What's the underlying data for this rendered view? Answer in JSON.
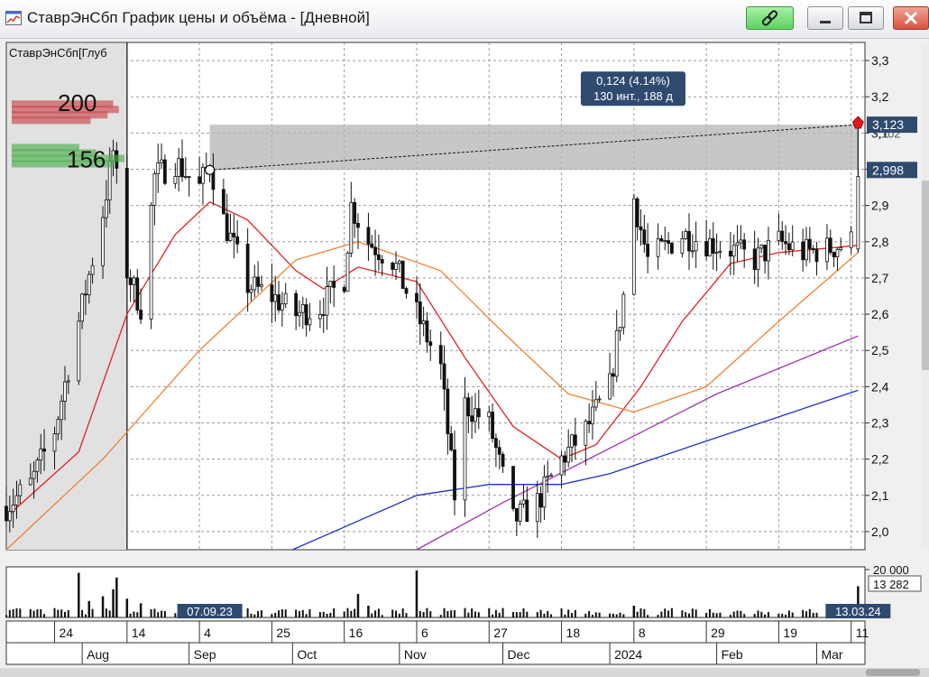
{
  "window": {
    "title": "СтаврЭнСбп График цены и объёма - [Дневной]",
    "icons": {
      "app": "chart-app-icon",
      "connect": "link-icon",
      "minimize": "minimize-icon",
      "maximize": "maximize-icon",
      "close": "close-icon"
    }
  },
  "chart_data": {
    "type": "candlestick",
    "instrument_label": "СтаврЭнСбп[Глуб",
    "ylim": [
      1.95,
      3.35
    ],
    "y_ticks": [
      "3,3",
      "3,2",
      "3,1",
      "3,0",
      "2,9",
      "2,8",
      "2,7",
      "2,6",
      "2,5",
      "2,4",
      "2,3",
      "2,2",
      "2,1",
      "2,0"
    ],
    "date_range": [
      "2023-07-10",
      "2024-03-15"
    ],
    "x_day_labels": [
      {
        "date": "2023-07-24",
        "label": "24"
      },
      {
        "date": "2023-08-14",
        "label": "14"
      },
      {
        "date": "2023-09-04",
        "label": "4"
      },
      {
        "date": "2023-09-25",
        "label": "25"
      },
      {
        "date": "2023-10-16",
        "label": "16"
      },
      {
        "date": "2023-11-06",
        "label": "6"
      },
      {
        "date": "2023-11-27",
        "label": "27"
      },
      {
        "date": "2023-12-18",
        "label": "18"
      },
      {
        "date": "2024-01-08",
        "label": "8"
      },
      {
        "date": "2024-01-29",
        "label": "29"
      },
      {
        "date": "2024-02-19",
        "label": "19"
      },
      {
        "date": "2024-03-11",
        "label": "11"
      }
    ],
    "x_month_labels": [
      {
        "date": "2023-08-01",
        "label": "Aug"
      },
      {
        "date": "2023-09-01",
        "label": "Sep"
      },
      {
        "date": "2023-10-01",
        "label": "Oct"
      },
      {
        "date": "2023-11-01",
        "label": "Nov"
      },
      {
        "date": "2023-12-01",
        "label": "Dec"
      },
      {
        "date": "2024-01-01",
        "label": "2024"
      },
      {
        "date": "2024-02-01",
        "label": "Feb"
      },
      {
        "date": "2024-03-01",
        "label": "Mar"
      }
    ],
    "price_path": [
      [
        "2023-07-10",
        2.07
      ],
      [
        "2023-07-17",
        2.13
      ],
      [
        "2023-07-24",
        2.28
      ],
      [
        "2023-07-31",
        2.58
      ],
      [
        "2023-08-07",
        2.88
      ],
      [
        "2023-08-10",
        3.05
      ],
      [
        "2023-08-14",
        2.72
      ],
      [
        "2023-08-18",
        2.62
      ],
      [
        "2023-08-22",
        2.98
      ],
      [
        "2023-08-28",
        3.02
      ],
      [
        "2023-09-04",
        2.95
      ],
      [
        "2023-09-07",
        3.02
      ],
      [
        "2023-09-11",
        2.86
      ],
      [
        "2023-09-18",
        2.68
      ],
      [
        "2023-09-25",
        2.65
      ],
      [
        "2023-10-02",
        2.6
      ],
      [
        "2023-10-09",
        2.62
      ],
      [
        "2023-10-16",
        2.7
      ],
      [
        "2023-10-18",
        2.9
      ],
      [
        "2023-10-23",
        2.8
      ],
      [
        "2023-10-30",
        2.75
      ],
      [
        "2023-11-06",
        2.6
      ],
      [
        "2023-11-13",
        2.45
      ],
      [
        "2023-11-17",
        2.1
      ],
      [
        "2023-11-20",
        2.35
      ],
      [
        "2023-11-27",
        2.3
      ],
      [
        "2023-12-01",
        2.15
      ],
      [
        "2023-12-04",
        2.03
      ],
      [
        "2023-12-11",
        2.08
      ],
      [
        "2023-12-18",
        2.2
      ],
      [
        "2023-12-25",
        2.28
      ],
      [
        "2024-01-01",
        2.4
      ],
      [
        "2024-01-05",
        2.65
      ],
      [
        "2024-01-08",
        2.92
      ],
      [
        "2024-01-12",
        2.75
      ],
      [
        "2024-01-22",
        2.82
      ],
      [
        "2024-01-29",
        2.8
      ],
      [
        "2024-02-05",
        2.78
      ],
      [
        "2024-02-12",
        2.75
      ],
      [
        "2024-02-19",
        2.8
      ],
      [
        "2024-02-26",
        2.77
      ],
      [
        "2024-03-04",
        2.78
      ],
      [
        "2024-03-11",
        2.8
      ],
      [
        "2024-03-13",
        3.123
      ]
    ],
    "ma_lines": [
      {
        "color": "#e02020",
        "path": [
          [
            "2023-07-10",
            2.04
          ],
          [
            "2023-07-31",
            2.22
          ],
          [
            "2023-08-14",
            2.6
          ],
          [
            "2023-08-28",
            2.82
          ],
          [
            "2023-09-07",
            2.91
          ],
          [
            "2023-09-18",
            2.86
          ],
          [
            "2023-10-02",
            2.72
          ],
          [
            "2023-10-10",
            2.67
          ],
          [
            "2023-10-20",
            2.73
          ],
          [
            "2023-11-06",
            2.69
          ],
          [
            "2023-11-20",
            2.48
          ],
          [
            "2023-12-04",
            2.29
          ],
          [
            "2023-12-18",
            2.2
          ],
          [
            "2023-12-28",
            2.24
          ],
          [
            "2024-01-10",
            2.4
          ],
          [
            "2024-01-22",
            2.58
          ],
          [
            "2024-02-05",
            2.74
          ],
          [
            "2024-02-19",
            2.77
          ],
          [
            "2024-03-13",
            2.79
          ]
        ]
      },
      {
        "color": "#f08030",
        "path": [
          [
            "2023-07-10",
            1.95
          ],
          [
            "2023-08-07",
            2.2
          ],
          [
            "2023-09-04",
            2.5
          ],
          [
            "2023-10-02",
            2.75
          ],
          [
            "2023-10-20",
            2.8
          ],
          [
            "2023-11-13",
            2.72
          ],
          [
            "2023-12-01",
            2.55
          ],
          [
            "2023-12-20",
            2.38
          ],
          [
            "2024-01-08",
            2.33
          ],
          [
            "2024-01-29",
            2.4
          ],
          [
            "2024-02-19",
            2.58
          ],
          [
            "2024-03-13",
            2.77
          ]
        ]
      },
      {
        "color": "#a030b0",
        "path": [
          [
            "2023-11-06",
            1.95
          ],
          [
            "2023-12-01",
            2.08
          ],
          [
            "2024-01-01",
            2.23
          ],
          [
            "2024-02-01",
            2.38
          ],
          [
            "2024-03-13",
            2.54
          ]
        ]
      },
      {
        "color": "#2030d0",
        "path": [
          [
            "2023-10-01",
            1.95
          ],
          [
            "2023-11-06",
            2.1
          ],
          [
            "2023-11-27",
            2.13
          ],
          [
            "2023-12-18",
            2.13
          ],
          [
            "2024-01-01",
            2.16
          ],
          [
            "2024-01-29",
            2.25
          ],
          [
            "2024-03-13",
            2.39
          ]
        ]
      }
    ],
    "measure": {
      "start": {
        "date": "2023-09-07",
        "price": 2.998
      },
      "end": {
        "date": "2024-03-13",
        "price": 3.123
      },
      "label_line1": "0,124 (4.14%)",
      "label_line2": "130 инт., 188 д",
      "low_label": "2,998",
      "high_label": "3,123",
      "extra_label": "3,102"
    },
    "highlight_range": [
      "2023-07-10",
      "2023-08-14"
    ],
    "depth": {
      "label_high": "200",
      "label_low": "156",
      "ask_bars": [
        [
          3.18,
          0.9
        ],
        [
          3.165,
          0.95
        ],
        [
          3.15,
          0.85
        ],
        [
          3.135,
          0.7
        ]
      ],
      "bid_bars": [
        [
          3.06,
          0.6
        ],
        [
          3.045,
          0.75
        ],
        [
          3.03,
          1.0
        ],
        [
          3.015,
          0.9
        ]
      ]
    },
    "volume": {
      "max_label": "20 000",
      "last_label": "13 282",
      "spikes": [
        [
          "2023-07-31",
          19000
        ],
        [
          "2023-08-03",
          7000
        ],
        [
          "2023-08-07",
          9000
        ],
        [
          "2023-08-10",
          12000
        ],
        [
          "2023-08-11",
          17000
        ],
        [
          "2023-08-14",
          8000
        ],
        [
          "2023-08-18",
          6000
        ],
        [
          "2023-10-20",
          10000
        ],
        [
          "2023-10-23",
          5000
        ],
        [
          "2023-11-06",
          20000
        ],
        [
          "2024-01-08",
          5000
        ],
        [
          "2024-03-13",
          13282
        ]
      ],
      "left_date_label": "07.09.23",
      "right_date_label": "13.03.24"
    }
  }
}
